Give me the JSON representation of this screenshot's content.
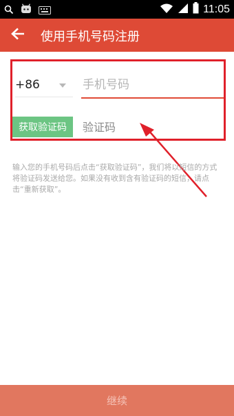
{
  "status_bar": {
    "time": "11:05",
    "icons": [
      "search-icon",
      "app-notification-icon",
      "keyboard-icon",
      "wifi-icon",
      "signal-icon",
      "battery-icon"
    ]
  },
  "app_bar": {
    "title": "使用手机号码注册",
    "back_icon": "arrow-left-icon",
    "color": "#de4a36"
  },
  "form": {
    "country_code": "+86",
    "phone_placeholder": "手机号码",
    "phone_value": "",
    "get_code_label": "获取验证码",
    "code_placeholder": "验证码",
    "code_value": ""
  },
  "info_text": "输入您的手机号码后点击“获取验证码”，我们将以短信的方式将验证码发送给您。如果没有收到含有验证码的短信，请点击“重新获取”。",
  "continue_button": {
    "label": "继续"
  },
  "annotation": {
    "color": "#e0202a"
  }
}
